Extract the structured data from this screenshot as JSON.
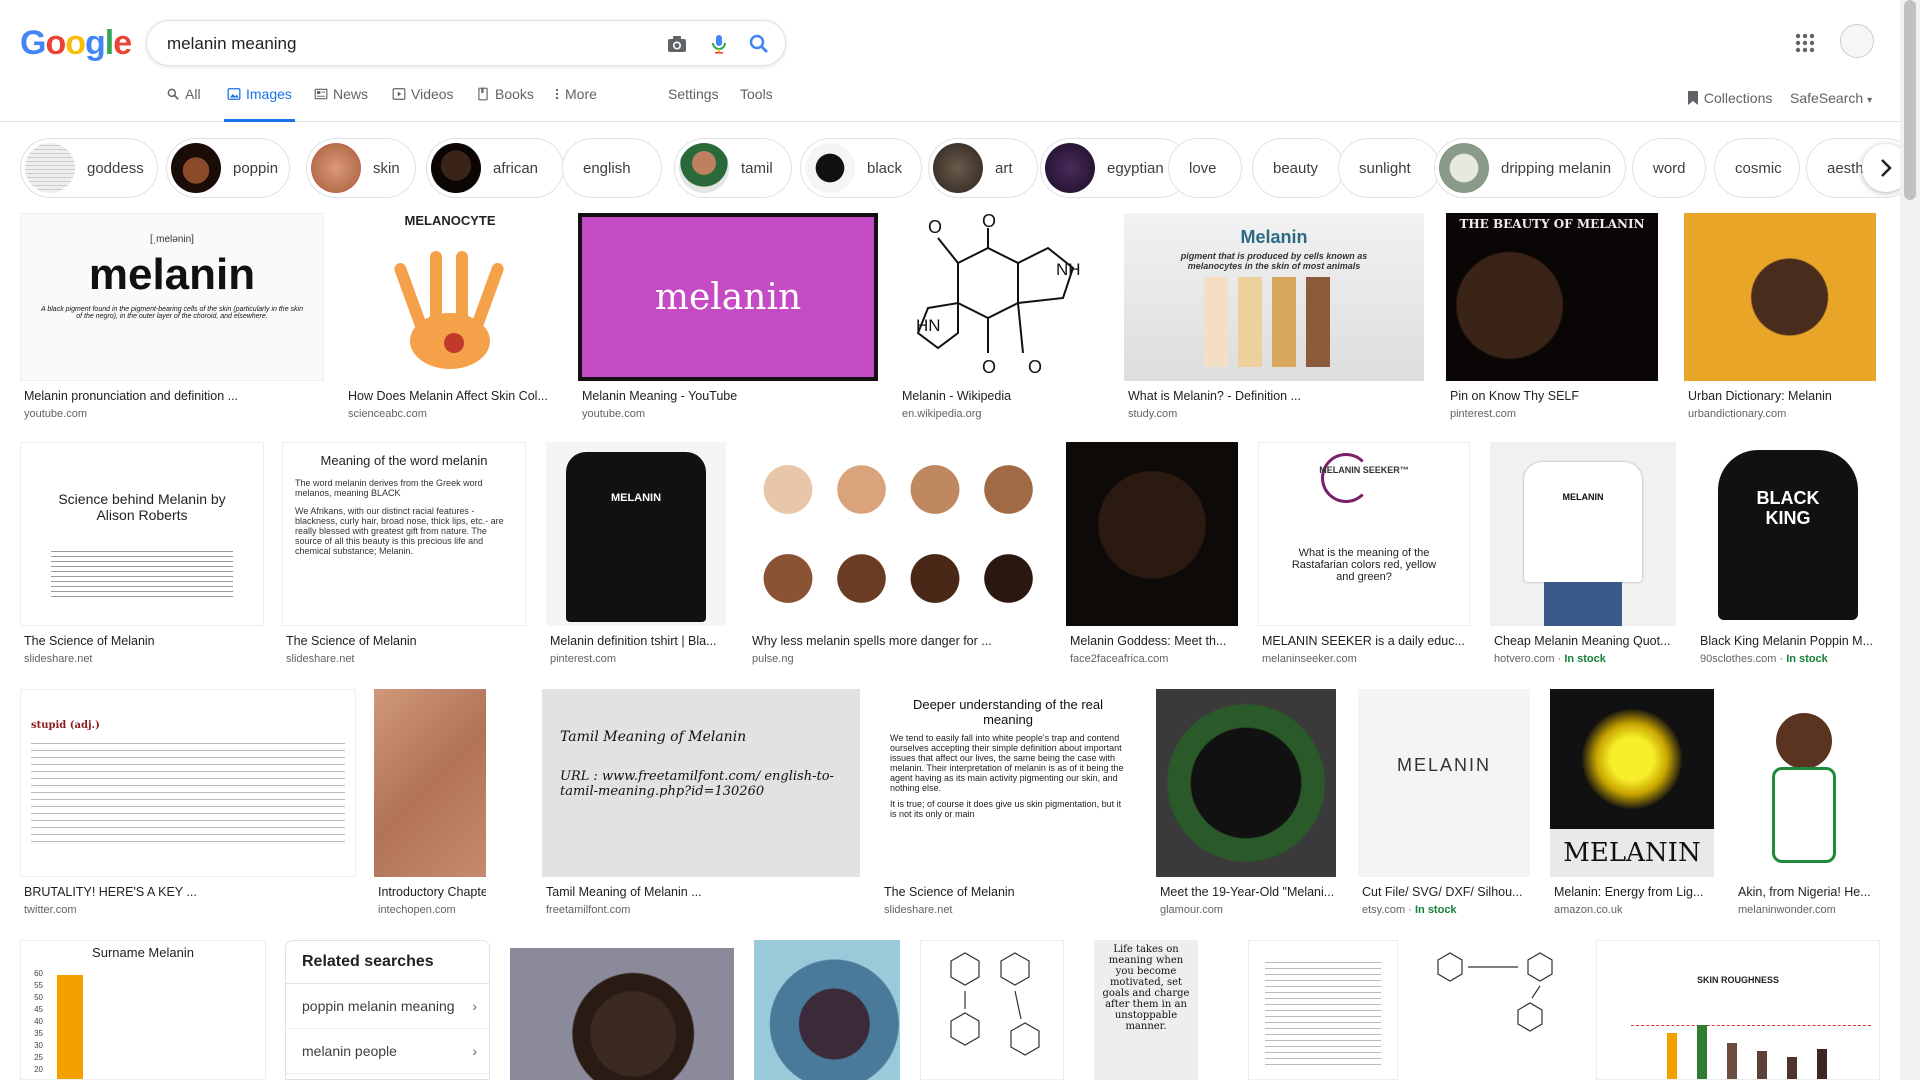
{
  "search": {
    "query": "melanin meaning"
  },
  "logo": {
    "text": "Google"
  },
  "tabs": [
    {
      "label": "All",
      "icon": "search-icon"
    },
    {
      "label": "Images",
      "icon": "image-icon",
      "active": true
    },
    {
      "label": "News",
      "icon": "news-icon"
    },
    {
      "label": "Videos",
      "icon": "video-icon"
    },
    {
      "label": "Books",
      "icon": "book-icon"
    },
    {
      "label": "More",
      "icon": "more-vert-icon"
    }
  ],
  "settings_label": "Settings",
  "tools_label": "Tools",
  "collections_label": "Collections",
  "safesearch_label": "SafeSearch",
  "chips": [
    {
      "label": "goddess"
    },
    {
      "label": "poppin"
    },
    {
      "label": "skin"
    },
    {
      "label": "african"
    },
    {
      "label": "english"
    },
    {
      "label": "tamil"
    },
    {
      "label": "black"
    },
    {
      "label": "art"
    },
    {
      "label": "egyptian"
    },
    {
      "label": "love"
    },
    {
      "label": "beauty"
    },
    {
      "label": "sunlight"
    },
    {
      "label": "dripping melanin"
    },
    {
      "label": "word"
    },
    {
      "label": "cosmic"
    },
    {
      "label": "aesthe"
    }
  ],
  "rows": [
    [
      {
        "caption": "Melanin pronunciation and definition ...",
        "source": "youtube.com"
      },
      {
        "caption": "How Does Melanin Affect Skin Col...",
        "source": "scienceabc.com"
      },
      {
        "caption": "Melanin Meaning - YouTube",
        "source": "youtube.com"
      },
      {
        "caption": "Melanin - Wikipedia",
        "source": "en.wikipedia.org"
      },
      {
        "caption": "What is Melanin? - Definition ...",
        "source": "study.com"
      },
      {
        "caption": "Pin on Know Thy SELF",
        "source": "pinterest.com"
      },
      {
        "caption": "Urban Dictionary: Melanin",
        "source": "urbandictionary.com"
      }
    ],
    [
      {
        "caption": "The Science of Melanin",
        "source": "slideshare.net"
      },
      {
        "caption": "The Science of Melanin",
        "source": "slideshare.net"
      },
      {
        "caption": "Melanin definition tshirt | Bla...",
        "source": "pinterest.com"
      },
      {
        "caption": "Why less melanin spells more danger for ...",
        "source": "pulse.ng"
      },
      {
        "caption": "Melanin Goddess: Meet th...",
        "source": "face2faceafrica.com"
      },
      {
        "caption": "MELANIN SEEKER is a daily educ...",
        "source": "melaninseeker.com"
      },
      {
        "caption": "Cheap Melanin Meaning Quot...",
        "source": "hotvero.com",
        "stock": "In stock"
      },
      {
        "caption": "Black King Melanin Poppin M...",
        "source": "90sclothes.com",
        "stock": "In stock"
      }
    ],
    [
      {
        "caption": "BRUTALITY! HERE'S A KEY ...",
        "source": "twitter.com"
      },
      {
        "caption": "Introductory Chapter: ...",
        "source": "intechopen.com"
      },
      {
        "caption": "Tamil Meaning of Melanin ...",
        "source": "freetamilfont.com"
      },
      {
        "caption": "The Science of Melanin",
        "source": "slideshare.net"
      },
      {
        "caption": "Meet the 19-Year-Old \"Melani...",
        "source": "glamour.com"
      },
      {
        "caption": "Cut File/ SVG/ DXF/ Silhou...",
        "source": "etsy.com",
        "stock": "In stock"
      },
      {
        "caption": "Melanin: Energy from Lig...",
        "source": "amazon.co.uk"
      },
      {
        "caption": "Akin, from Nigeria! He...",
        "source": "melaninwonder.com"
      }
    ]
  ],
  "image_text": {
    "pron": "[ˌmelənin]",
    "melanin_word": "melanin",
    "pron_def": "A black pigment found in the pigment-bearing cells of the skin (particularly in the skin of the negro), in the outer layer of the choroid, and elsewhere.",
    "melanocyte": "MELANOCYTE",
    "yt_word": "melanin",
    "study_title": "Melanin",
    "study_sub": "pigment that is produced by cells known as melanocytes in the skin of most animals",
    "beauty_title": "THE BEAUTY OF MELANIN",
    "sci_title": "Science behind Melanin by Alison Roberts",
    "word_title": "Meaning of the word melanin",
    "word_p1": "The word melanin derives from the Greek word melanos, meaning BLACK",
    "word_p2": "We Afrikans, with our distinct racial features -blackness, curly hair, broad nose, thick lips, etc.- are really blessed with greatest gift from nature. The source of all this beauty is this precious life and chemical substance; Melanin.",
    "seeker_logo": "MELANIN SEEKER™",
    "seeker_q": "What is the meaning of the Rastafarian colors red, yellow and green?",
    "tee_text": "MELANIN",
    "king_text": "BLACK KING",
    "stupid_head": "stupid (adj.)",
    "tamil_title": "Tamil Meaning of Melanin",
    "tamil_url": "URL : www.freetamilfont.com/ english-to-tamil-meaning.php?id=130260",
    "deeper_title": "Deeper understanding of the real meaning",
    "deeper_p1": "We tend to easily fall into white people's trap and contend ourselves accepting their simple definition about important issues that affect our lives, the same being the case with melanin. Their interpretation of melanin is as of it being the agent having as its main activity pigmenting our skin, and nothing else.",
    "deeper_p2": "It is true; of course it does give us skin pigmentation, but it is not its only or main",
    "cut_title": "MELANIN",
    "amazon_word": "MELANIN",
    "surname_title": "Surname Melanin",
    "life_quote": "Life takes on meaning when you become motivated, set goals and charge after them in an unstoppable manner.",
    "skin_rough": "SKIN ROUGHNESS"
  },
  "related": {
    "title": "Related searches",
    "items": [
      {
        "label": "poppin melanin meaning"
      },
      {
        "label": "melanin people"
      }
    ]
  },
  "surname_chart": {
    "title": "Surname Melanin",
    "ticks": [
      "60",
      "55",
      "50",
      "45",
      "40",
      "35",
      "30",
      "25",
      "20"
    ]
  },
  "colors": {
    "accent": "#1a73e8",
    "stock": "#188038",
    "border": "#dfe1e5"
  }
}
